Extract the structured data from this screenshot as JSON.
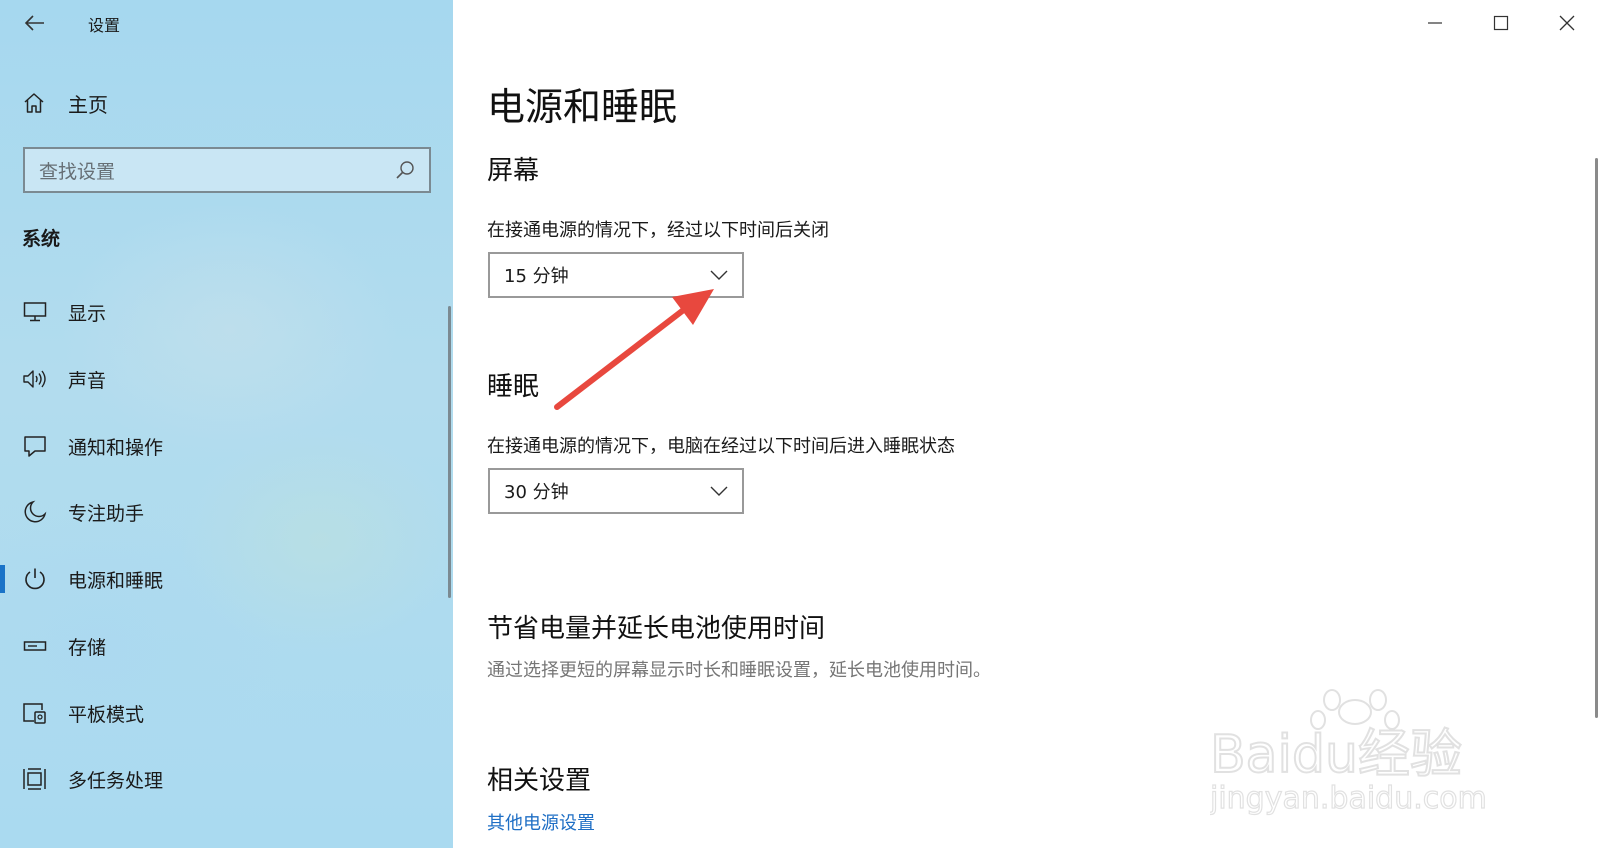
{
  "window": {
    "title": "设置",
    "controls": [
      "minimize",
      "maximize",
      "close"
    ]
  },
  "sidebar": {
    "home_label": "主页",
    "search_placeholder": "查找设置",
    "section_heading": "系统",
    "items": [
      {
        "label": "显示",
        "icon": "monitor-icon"
      },
      {
        "label": "声音",
        "icon": "speaker-icon"
      },
      {
        "label": "通知和操作",
        "icon": "notification-icon"
      },
      {
        "label": "专注助手",
        "icon": "moon-icon"
      },
      {
        "label": "电源和睡眠",
        "icon": "power-icon",
        "selected": true
      },
      {
        "label": "存储",
        "icon": "storage-icon"
      },
      {
        "label": "平板模式",
        "icon": "tablet-mode-icon"
      },
      {
        "label": "多任务处理",
        "icon": "multitasking-icon"
      }
    ]
  },
  "main": {
    "page_title": "电源和睡眠",
    "screen": {
      "heading": "屏幕",
      "description": "在接通电源的情况下，经过以下时间后关闭",
      "selected_value": "15 分钟"
    },
    "sleep": {
      "heading": "睡眠",
      "description": "在接通电源的情况下，电脑在经过以下时间后进入睡眠状态",
      "selected_value": "30 分钟"
    },
    "battery": {
      "heading": "节省电量并延长电池使用时间",
      "description": "通过选择更短的屏幕显示时长和睡眠设置，延长电池使用时间。"
    },
    "related": {
      "heading": "相关设置",
      "link": "其他电源设置"
    }
  },
  "watermark": {
    "brand": "Baidu经验",
    "url": "jingyan.baidu.com"
  },
  "colors": {
    "accent": "#1a73c8",
    "link": "#1f6fc5",
    "annotation_arrow": "#e8483e",
    "sidebar_bg": "#aad8ee"
  }
}
